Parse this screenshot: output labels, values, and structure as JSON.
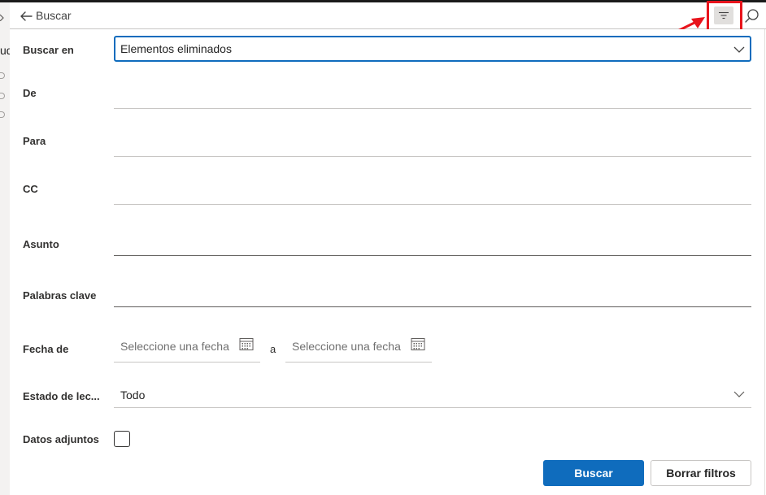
{
  "search_bar": {
    "title": "Buscar",
    "left_fragment": "ud"
  },
  "icons": {
    "back": "arrow-left-icon",
    "filter": "filter-lines-icon",
    "search": "magnifier-icon",
    "calendar": "calendar-icon",
    "chevron": "chevron-down-icon"
  },
  "colors": {
    "accent": "#0f6cbd",
    "annotation": "#e8141c"
  },
  "form": {
    "folder": {
      "label": "Buscar en",
      "value": "Elementos eliminados"
    },
    "from": {
      "label": "De"
    },
    "to": {
      "label": "Para"
    },
    "cc": {
      "label": "CC"
    },
    "subject": {
      "label": "Asunto"
    },
    "keywords": {
      "label": "Palabras clave"
    },
    "date": {
      "label": "Fecha de",
      "from_placeholder": "Seleccione una fecha",
      "separator": "a",
      "to_placeholder": "Seleccione una fecha"
    },
    "read_status": {
      "label": "Estado de lec...",
      "value": "Todo"
    },
    "attachments": {
      "label": "Datos adjuntos"
    }
  },
  "buttons": {
    "search": "Buscar",
    "clear": "Borrar filtros"
  }
}
